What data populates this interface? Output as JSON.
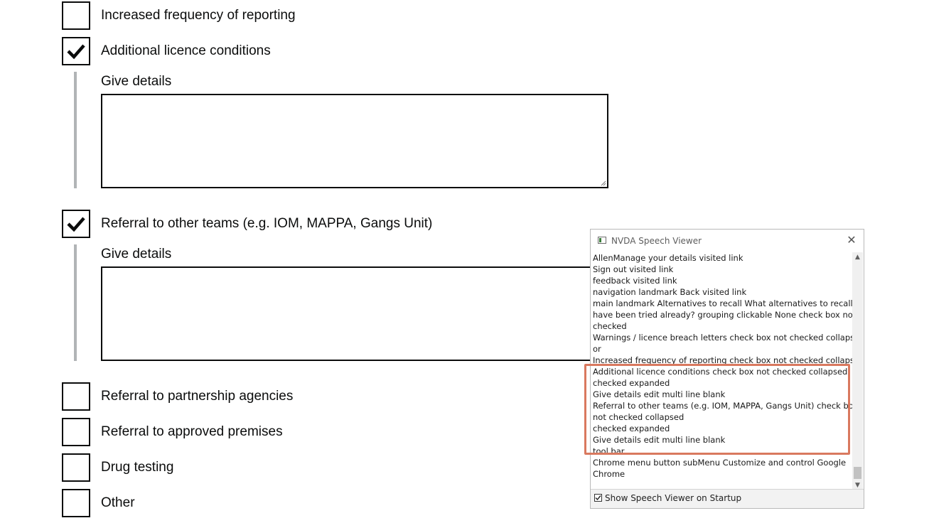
{
  "form": {
    "options": [
      {
        "label": "Increased frequency of reporting",
        "checked": false
      },
      {
        "label": "Additional licence conditions",
        "checked": true,
        "details_label": "Give details",
        "details_value": ""
      },
      {
        "label": "Referral to other teams (e.g. IOM, MAPPA, Gangs Unit)",
        "checked": true,
        "details_label": "Give details",
        "details_value": ""
      },
      {
        "label": "Referral to partnership agencies",
        "checked": false
      },
      {
        "label": "Referral to approved premises",
        "checked": false
      },
      {
        "label": "Drug testing",
        "checked": false
      },
      {
        "label": "Other",
        "checked": false
      }
    ],
    "checkmark_icon": "check-icon"
  },
  "nvda": {
    "title": "NVDA Speech Viewer",
    "close_icon": "close-icon",
    "lines": [
      "AllenManage your details  visited  link",
      "Sign out  visited  link",
      "feedback  visited  link",
      "navigation landmark    Back  visited  link",
      "main landmark    Alternatives to recall  What alternatives to recall",
      "have been tried already?  grouping  clickable  None  check box  not",
      "checked",
      "Warnings / licence breach letters  check box  not checked  collapsed",
      "or",
      "Increased frequency of reporting  check box  not checked  collapsed",
      "Additional licence conditions  check box  not checked  collapsed",
      "checked  expanded",
      "Give details  edit  multi line  blank",
      "Referral to other teams (e.g. IOM, MAPPA, Gangs Unit)  check box",
      "not checked  collapsed",
      "checked  expanded",
      "Give details  edit  multi line  blank",
      "tool bar",
      "Chrome  menu button  subMenu  Customize and control Google",
      "Chrome"
    ],
    "footer_checkbox_label": "Show Speech Viewer on Startup",
    "footer_checked": true
  },
  "colors": {
    "text": "#0b0c0c",
    "conditional_bar": "#b1b4b6",
    "highlight_border": "#d9795f"
  }
}
